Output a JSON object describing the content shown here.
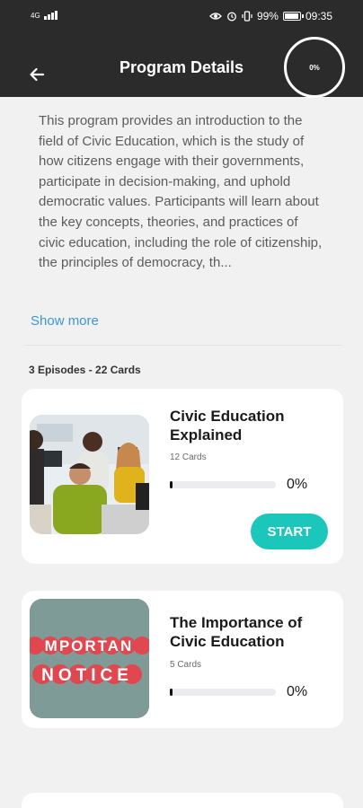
{
  "status_bar": {
    "signal_text": "4G",
    "battery": "99%",
    "time": "09:35",
    "icons": [
      "signal-icon",
      "eye-icon",
      "alarm-icon",
      "vibrate-icon",
      "battery-icon"
    ]
  },
  "app_bar": {
    "title": "Program Details",
    "progress_label": "0%",
    "back_icon": "back-arrow-icon"
  },
  "description": {
    "text": "This program provides an introduction to the field of Civic Education, which is the study of how citizens engage with their governments, participate in decision-making, and uphold democratic values. Participants will learn about the key concepts, theories, and practices of civic education, including the role of citizenship, the principles of democracy, th...",
    "show_more": "Show more"
  },
  "summary": "3 Episodes - 22 Cards",
  "episodes": [
    {
      "title": "Civic Education Explained",
      "cards": "12 Cards",
      "progress": 0,
      "progress_label": "0%",
      "button": "START",
      "image": "students-at-computer-photo"
    },
    {
      "title": "The Importance of Civic Education",
      "cards": "5 Cards",
      "progress": 0,
      "progress_label": "0%",
      "image": "important-notice-photo",
      "image_text_line1": "MPORTAN",
      "image_text_line2": "NOTICE"
    }
  ],
  "colors": {
    "header_bg": "#2b2b2b",
    "accent": "#1bc6bb",
    "link": "#3d97d3",
    "page_bg": "#f1f1f1"
  }
}
